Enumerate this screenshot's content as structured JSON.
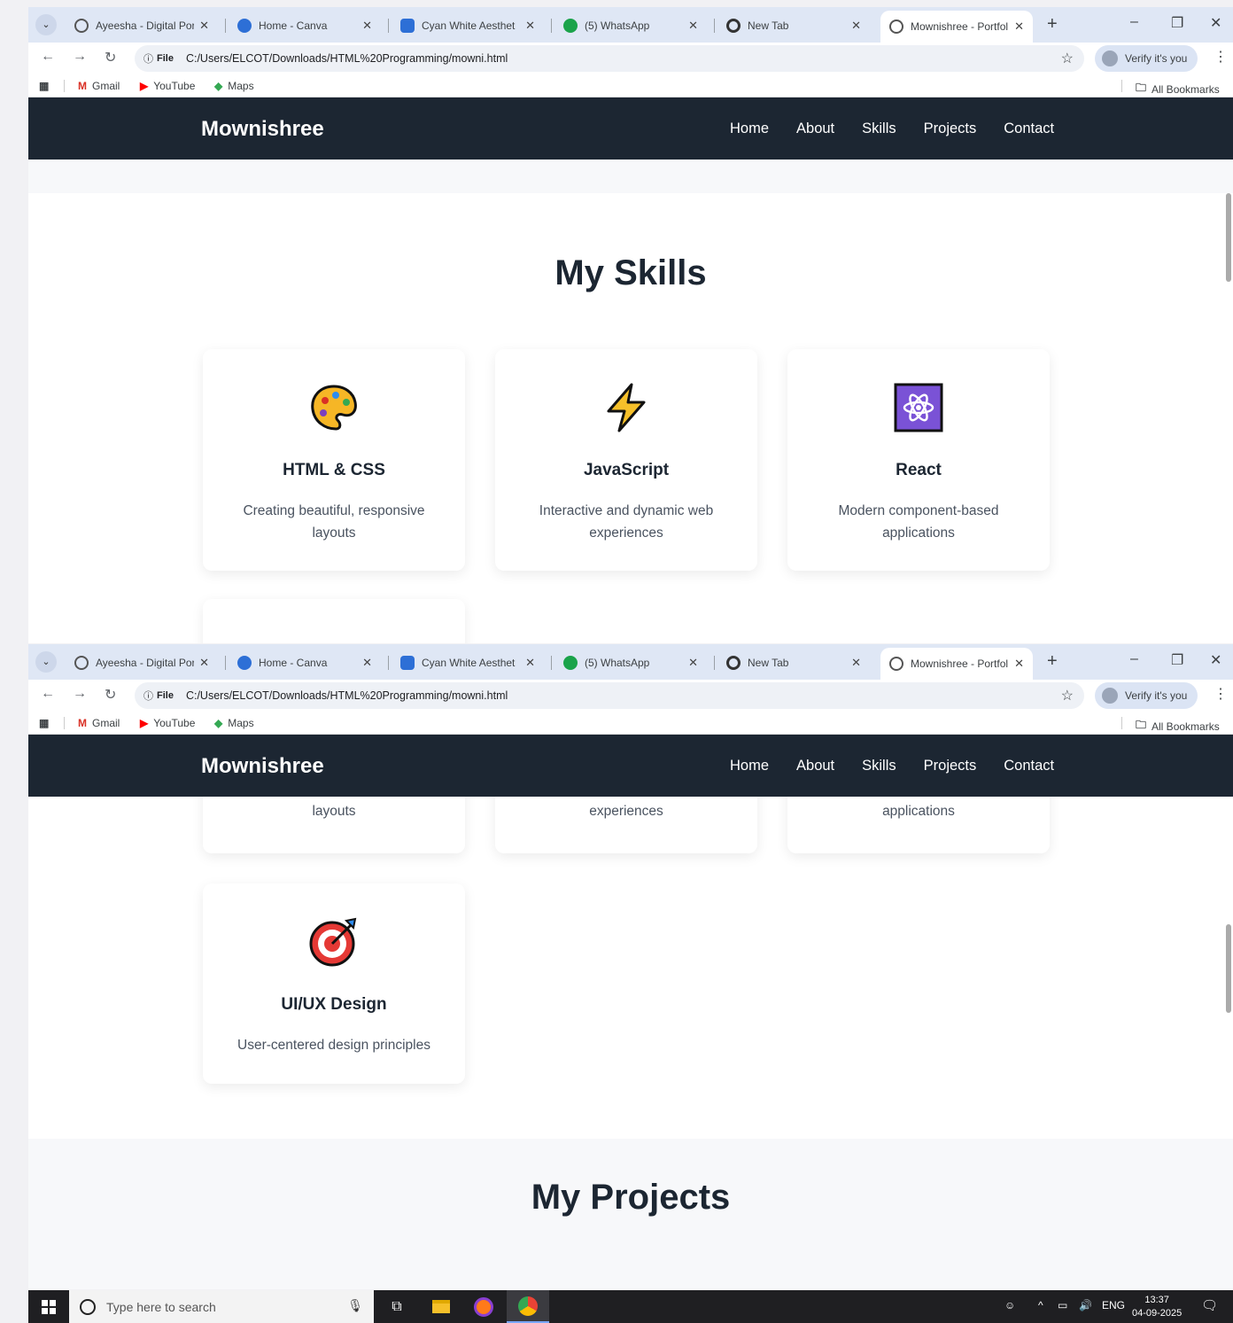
{
  "browser": {
    "tabs": [
      {
        "title": "Ayeesha - Digital Por",
        "icon": "globe-icon",
        "color": "#555555"
      },
      {
        "title": "Home - Canva",
        "icon": "canva-icon",
        "color": "#2d6fd6"
      },
      {
        "title": "Cyan White Aesthet",
        "icon": "chat-icon",
        "color": "#2d6fd6"
      },
      {
        "title": "(5) WhatsApp",
        "icon": "whatsapp-icon",
        "color": "#1aa34a"
      },
      {
        "title": "New Tab",
        "icon": "chrome-icon",
        "color": "#333333"
      },
      {
        "title": "Mownishree - Portfol",
        "icon": "globe-icon",
        "color": "#555555",
        "active": true
      }
    ],
    "address": {
      "scheme_label": "File",
      "url": "C:/Users/ELCOT/Downloads/HTML%20Programming/mowni.html"
    },
    "verify_label": "Verify it's you",
    "bookmarks": [
      {
        "label": "Gmail",
        "icon": "gmail-icon",
        "color": "#d93025"
      },
      {
        "label": "YouTube",
        "icon": "youtube-icon",
        "color": "#ff0000"
      },
      {
        "label": "Maps",
        "icon": "maps-icon",
        "color": "#34a853"
      }
    ],
    "all_bookmarks_label": "All Bookmarks"
  },
  "site": {
    "brand": "Mownishree",
    "nav": [
      "Home",
      "About",
      "Skills",
      "Projects",
      "Contact"
    ],
    "skills_title": "My Skills",
    "projects_title": "My Projects",
    "skills": [
      {
        "title": "HTML & CSS",
        "desc": "Creating beautiful, responsive layouts",
        "icon": "palette-icon"
      },
      {
        "title": "JavaScript",
        "desc": "Interactive and dynamic web experiences",
        "icon": "lightning-icon"
      },
      {
        "title": "React",
        "desc": "Modern component-based applications",
        "icon": "atom-icon"
      },
      {
        "title": "UI/UX Design",
        "desc": "User-centered design principles",
        "icon": "target-icon"
      }
    ],
    "partial_desc_tail": [
      "layouts",
      "experiences",
      "applications"
    ]
  },
  "taskbar": {
    "search_placeholder": "Type here to search",
    "language": "ENG",
    "time": "13:37",
    "date": "04-09-2025"
  },
  "colors": {
    "nav_bg": "#1c2632",
    "tabstrip_bg": "#dfe7f5",
    "heading": "#1c2632"
  }
}
